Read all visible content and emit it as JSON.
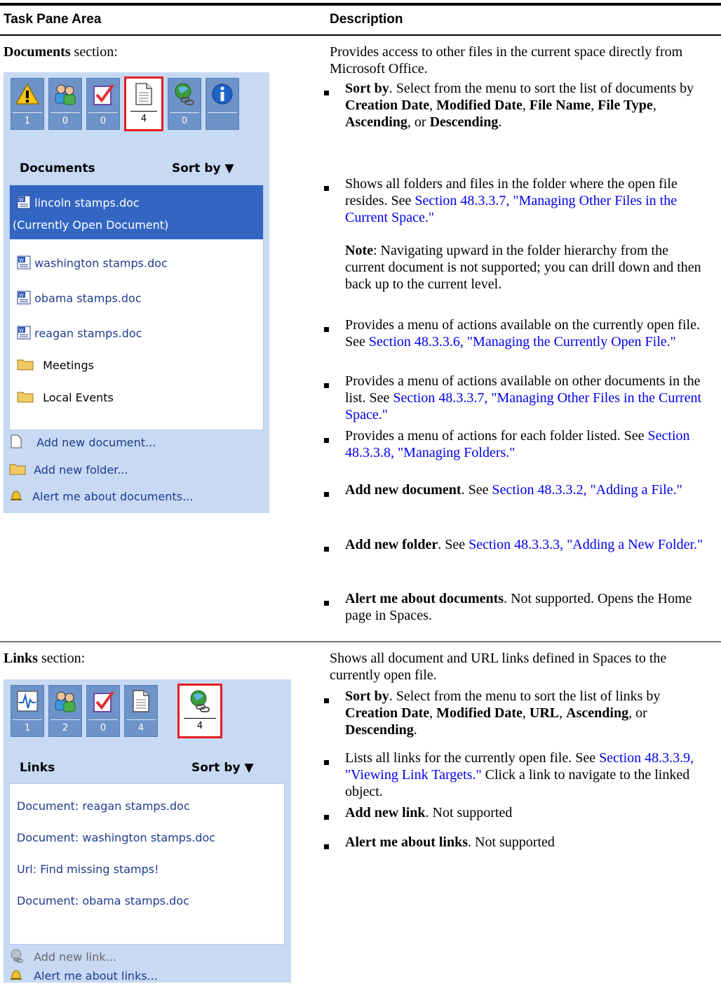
{
  "header": {
    "col1": "Task Pane Area",
    "col2": "Description"
  },
  "documents_row": {
    "label_bold": "Documents",
    "label_rest": " section:",
    "intro": "Provides access to other files in the current space directly from Microsoft Office.",
    "pane": {
      "icons": [
        {
          "name": "warning",
          "count": "1"
        },
        {
          "name": "people",
          "count": "0"
        },
        {
          "name": "tasks",
          "count": "0"
        },
        {
          "name": "document",
          "count": "4",
          "selected": true
        },
        {
          "name": "link",
          "count": "0"
        },
        {
          "name": "info",
          "count": ""
        }
      ],
      "title": "Documents",
      "sort": "Sort by ▼",
      "selected_item": "lincoln stamps.doc",
      "selected_note": "(Currently Open Document)",
      "items": [
        "washington stamps.doc",
        "obama stamps.doc",
        "reagan stamps.doc"
      ],
      "folders": [
        "Meetings",
        "Local Events"
      ],
      "footer": [
        "Add new document...",
        "Add new folder...",
        "Alert me about documents..."
      ]
    },
    "b1": {
      "bold": "Sort by",
      "t1": ". Select from the menu to sort the list of documents by ",
      "b2": "Creation Date",
      "t2": ", ",
      "b3": "Modified Date",
      ",": ",",
      "b4": "File Name",
      "t4": ", ",
      "b5": "File Type",
      "t5": ", ",
      "b6": "Ascending",
      "t6": ", or ",
      "b7": "Descending",
      "t7": "."
    },
    "b2": {
      "t": "Shows all folders and files in the folder where the open file resides. See ",
      "link": "Section 48.3.3.7, \"Managing Other Files in the Current Space.\""
    },
    "note": {
      "bold": "Note",
      "t": ": Navigating upward in the folder hierarchy from the current document is not supported; you can drill down and then back up to the current level."
    },
    "b3": {
      "t": "Provides a menu of actions available on the currently open file. See ",
      "link": "Section 48.3.3.6, \"Managing the Currently Open File.\""
    },
    "b4": {
      "t": "Provides a menu of actions available on other documents in the list. See ",
      "link": "Section 48.3.3.7, \"Managing Other Files in the Current Space.\""
    },
    "b5": {
      "t": "Provides a menu of actions for each folder listed. See ",
      "link": "Section 48.3.3.8, \"Managing Folders.\""
    },
    "b6": {
      "bold": "Add new document",
      "t": ". See ",
      "link": "Section 48.3.3.2, \"Adding a File.\""
    },
    "b7": {
      "bold": "Add new folder",
      "t": ". See ",
      "link": "Section 48.3.3.3, \"Adding a New Folder.\""
    },
    "b8": {
      "bold": "Alert me about documents",
      "t": ". Not supported. Opens the Home page in Spaces."
    }
  },
  "links_row": {
    "label_bold": "Links",
    "label_rest": " section:",
    "intro": "Shows all document and URL links defined in Spaces to the currently open file.",
    "pane": {
      "icons": [
        {
          "name": "activity",
          "count": "1"
        },
        {
          "name": "people",
          "count": "2"
        },
        {
          "name": "tasks",
          "count": "0"
        },
        {
          "name": "document",
          "count": "4"
        },
        {
          "name": "link",
          "count": "4",
          "selected": true
        }
      ],
      "title": "Links",
      "sort": "Sort by ▼",
      "items": [
        "Document: reagan stamps.doc",
        "Document: washington stamps.doc",
        "Url: Find missing stamps!",
        "Document: obama stamps.doc"
      ],
      "footer": [
        "Add new link...",
        "Alert me about links..."
      ]
    },
    "b1": {
      "bold": "Sort by",
      "t1": ". Select from the menu to sort the list of links by ",
      "b2": "Creation Date",
      "t2": ", ",
      "b3": "Modified Date",
      "t3": ", ",
      "b4": "URL",
      "t4": ", ",
      "b5": "Ascending",
      "t5": ", or ",
      "b6": "Descending",
      "t6": "."
    },
    "b2": {
      "t": "Lists all links for the currently open file. See ",
      "link": "Section 48.3.3.9, \"Viewing Link Targets.\"",
      "t2": " Click a link to navigate to the linked object."
    },
    "b3": {
      "bold": "Add new link",
      "t": ". Not supported"
    },
    "b4": {
      "bold": "Alert me about links",
      "t": ". Not supported"
    }
  }
}
